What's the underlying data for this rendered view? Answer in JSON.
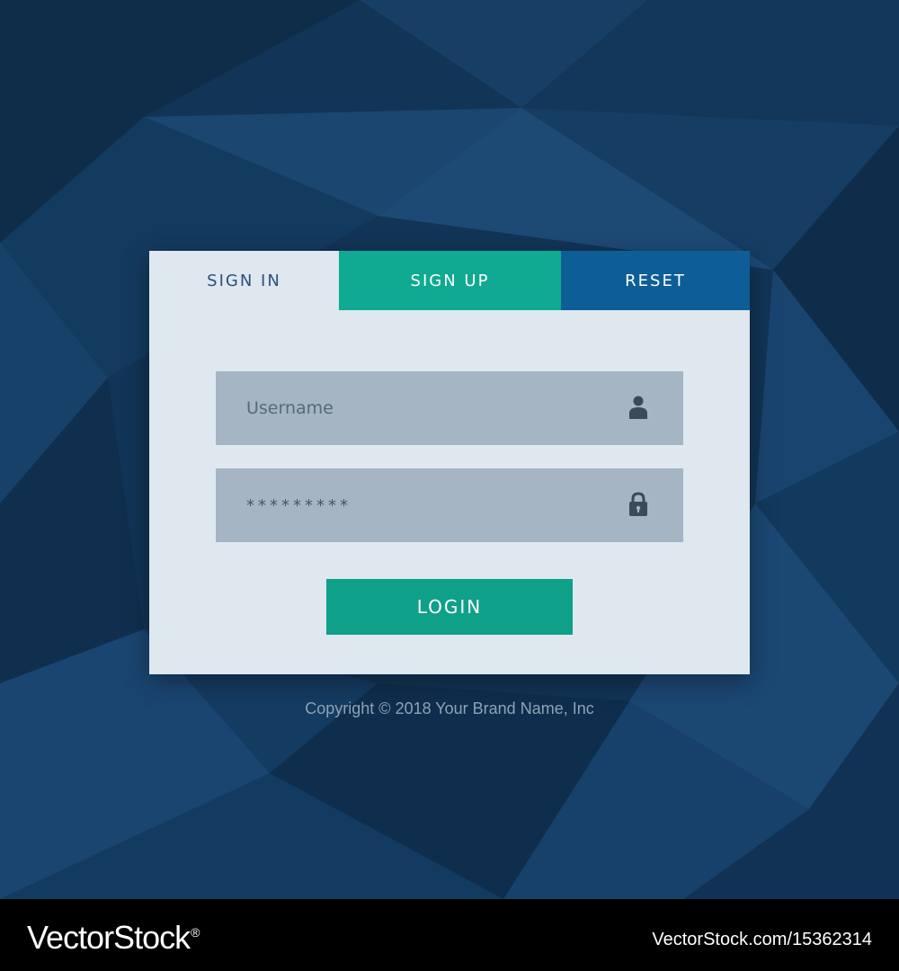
{
  "tabs": {
    "sign_in": "SIGN IN",
    "sign_up": "SIGN UP",
    "reset": "RESET"
  },
  "form": {
    "username_placeholder": "Username",
    "password_value": "*********",
    "login_label": "LOGIN",
    "username_icon": "user-icon",
    "password_icon": "lock-icon"
  },
  "copyright": "Copyright © 2018 Your Brand Name, Inc",
  "footer": {
    "brand": "VectorStock",
    "brand_mark": "®",
    "image_id": "VectorStock.com/15362314"
  },
  "colors": {
    "background": "#10304f",
    "card": "#dfe7ef",
    "tab_signup": "#0faa91",
    "tab_reset": "#0d5e96",
    "field": "#a5b5c3",
    "login_button": "#0fa089"
  }
}
